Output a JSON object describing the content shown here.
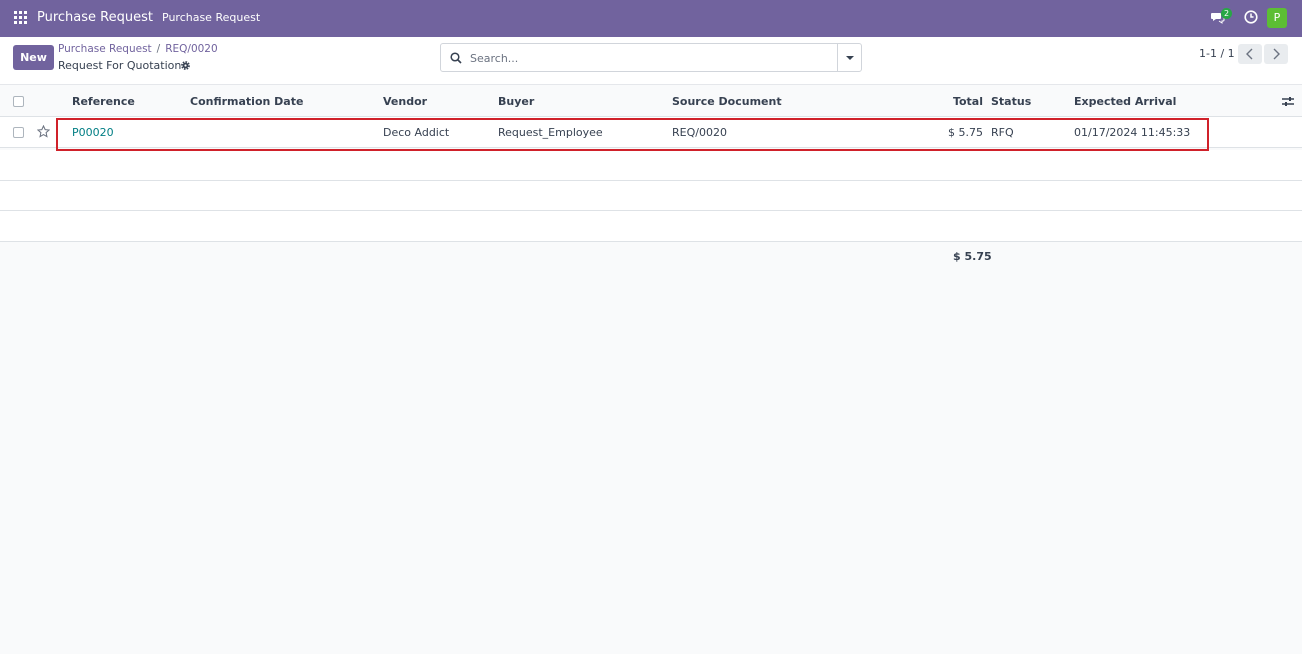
{
  "navbar": {
    "brand": "Purchase Request",
    "menu_item": "Purchase Request",
    "chat_badge": "2",
    "avatar_letter": "P",
    "accent_color": "#71639e"
  },
  "control": {
    "new_label": "New",
    "breadcrumb": [
      "Purchase Request",
      "REQ/0020"
    ],
    "subtitle": "Request For Quotation",
    "search_placeholder": "Search...",
    "pager": "1-1 / 1"
  },
  "table": {
    "columns": [
      "Reference",
      "Confirmation Date",
      "Vendor",
      "Buyer",
      "Source Document",
      "Total",
      "Status",
      "Expected Arrival"
    ],
    "rows": [
      {
        "reference": "P00020",
        "confirmation_date": "",
        "vendor": "Deco Addict",
        "buyer": "Request_Employee",
        "source_document": "REQ/0020",
        "total": "$ 5.75",
        "status": "RFQ",
        "expected_arrival": "01/17/2024 11:45:33"
      }
    ],
    "footer_total": "$ 5.75"
  }
}
